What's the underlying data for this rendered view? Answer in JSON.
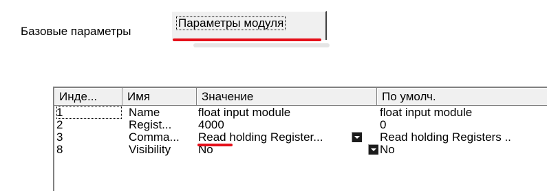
{
  "tabs": {
    "base_label": "Базовые параметры",
    "module_label": "Параметры модуля"
  },
  "grid": {
    "columns": [
      "Инде...",
      "Имя",
      "Значение",
      "По умолч."
    ],
    "rows": [
      {
        "index": "1",
        "name": "Name",
        "value": "float input module",
        "default": "float input module",
        "has_dropdown": false
      },
      {
        "index": "2",
        "name": "Regist...",
        "value": "4000",
        "default": "0",
        "has_dropdown": false
      },
      {
        "index": "3",
        "name": "Comma...",
        "value": "Read holding Register...",
        "default": "Read holding Registers ..",
        "has_dropdown": true
      },
      {
        "index": "8",
        "name": "Visibility",
        "value": "No",
        "default": "No",
        "has_dropdown": true
      }
    ]
  },
  "highlight_color": "#e5101a"
}
